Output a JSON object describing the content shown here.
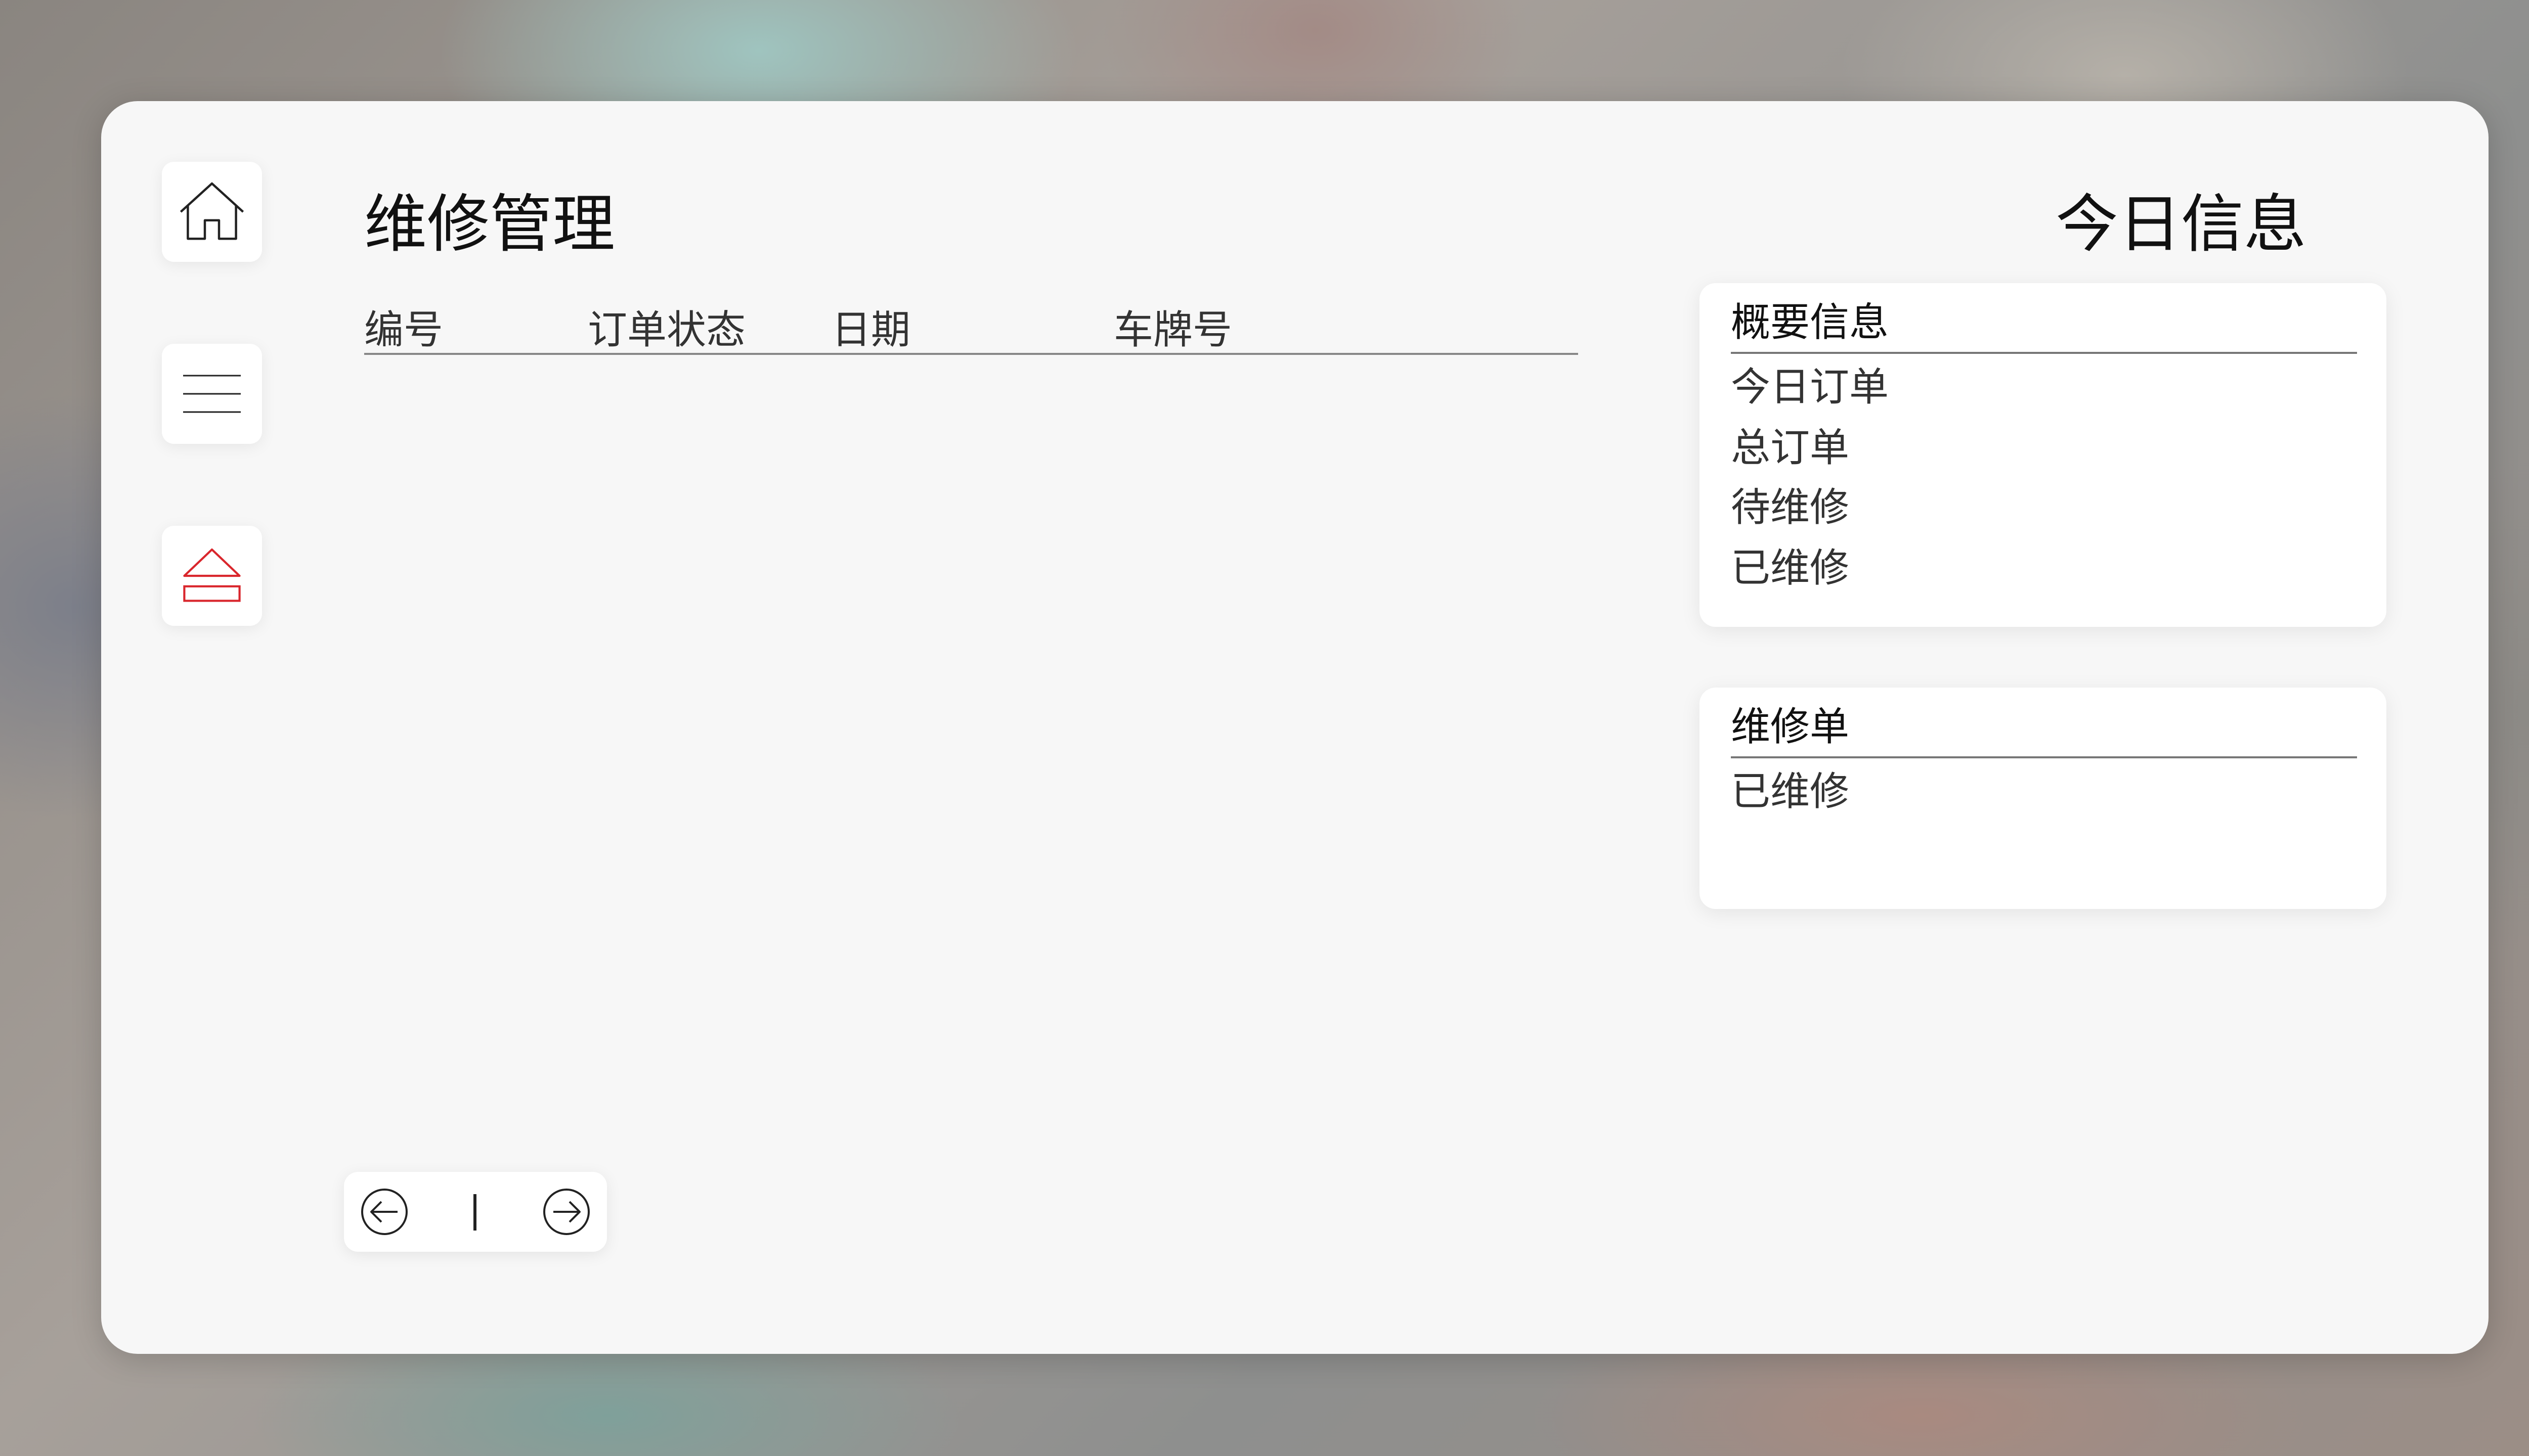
{
  "sidebar": {
    "items": [
      {
        "name": "home",
        "icon": "home-icon"
      },
      {
        "name": "menu",
        "icon": "menu-icon"
      },
      {
        "name": "eject",
        "icon": "eject-icon",
        "color": "#d9262c"
      }
    ]
  },
  "main": {
    "title": "维修管理",
    "table": {
      "columns": [
        "编号",
        "订单状态",
        "日期",
        "车牌号"
      ],
      "rows": []
    },
    "pagination": {
      "prev_icon": "arrow-left-circle-icon",
      "next_icon": "arrow-right-circle-icon"
    }
  },
  "right": {
    "title": "今日信息",
    "summary_card": {
      "title": "概要信息",
      "items": [
        "今日订单",
        "总订单",
        "待维修",
        "已维修"
      ]
    },
    "repair_card": {
      "title": "维修单",
      "items": [
        "已维修"
      ]
    }
  },
  "colors": {
    "panel": "#f7f7f7",
    "accent_red": "#d9262c",
    "divider": "#888888"
  }
}
